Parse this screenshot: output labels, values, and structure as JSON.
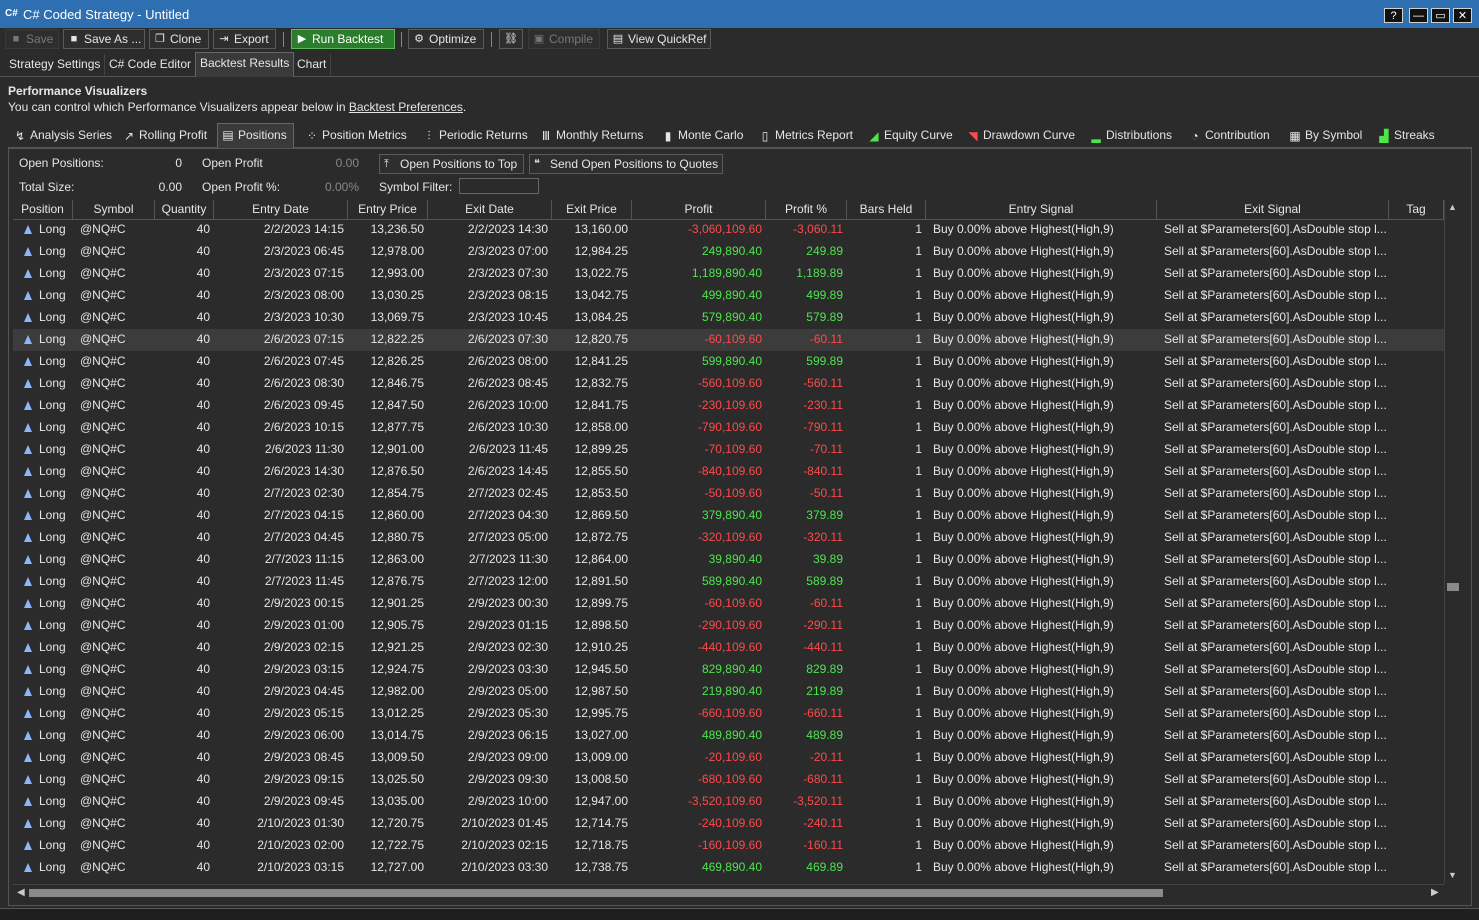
{
  "window": {
    "title": "C# Coded Strategy - Untitled",
    "app_icon": "C#",
    "buttons": [
      "?",
      "—",
      "▭",
      "✕"
    ]
  },
  "toolbar": {
    "save": "Save",
    "save_as": "Save As ...",
    "clone": "Clone",
    "export": "Export",
    "run_backtest": "Run Backtest",
    "optimize": "Optimize",
    "compile": "Compile",
    "view_quickref": "View QuickRef"
  },
  "main_tabs": [
    "Strategy Settings",
    "C# Code Editor",
    "Backtest Results",
    "Chart"
  ],
  "performance": {
    "title": "Performance Visualizers",
    "desc_prefix": "You can control which Performance Visualizers appear below in ",
    "desc_link": "Backtest Preferences",
    "desc_suffix": "."
  },
  "viz_tabs": [
    "Analysis Series",
    "Rolling Profit",
    "Positions",
    "Position Metrics",
    "Periodic Returns",
    "Monthly Returns",
    "Monte Carlo",
    "Metrics Report",
    "Equity Curve",
    "Drawdown Curve",
    "Distributions",
    "Contribution",
    "By Symbol",
    "Streaks"
  ],
  "summary": {
    "open_positions_label": "Open Positions:",
    "open_positions": "0",
    "open_profit_label": "Open Profit",
    "open_profit": "0.00",
    "total_size_label": "Total Size:",
    "total_size": "0.00",
    "open_profit_pct_label": "Open Profit %:",
    "open_profit_pct": "0.00%",
    "symbol_filter_label": "Symbol Filter:",
    "open_to_top_button": "Open Positions to Top",
    "send_to_quotes_button": "Send Open Positions to Quotes"
  },
  "table": {
    "columns": [
      "Position",
      "Symbol",
      "Quantity",
      "Entry Date",
      "Entry Price",
      "Exit Date",
      "Exit Price",
      "Profit",
      "Profit %",
      "Bars Held",
      "Entry Signal",
      "Exit Signal",
      "Tag"
    ],
    "selected_row": 5,
    "rows": [
      [
        "Long",
        "@NQ#C",
        "40",
        "2/2/2023 14:15",
        "13,236.50",
        "2/2/2023 14:30",
        "13,160.00",
        "-3,060,109.60",
        "-3,060.11",
        "1",
        "Buy 0.00% above Highest(High,9)",
        "Sell at $Parameters[60].AsDouble stop l..."
      ],
      [
        "Long",
        "@NQ#C",
        "40",
        "2/3/2023 06:45",
        "12,978.00",
        "2/3/2023 07:00",
        "12,984.25",
        "249,890.40",
        "249.89",
        "1",
        "Buy 0.00% above Highest(High,9)",
        "Sell at $Parameters[60].AsDouble stop l..."
      ],
      [
        "Long",
        "@NQ#C",
        "40",
        "2/3/2023 07:15",
        "12,993.00",
        "2/3/2023 07:30",
        "13,022.75",
        "1,189,890.40",
        "1,189.89",
        "1",
        "Buy 0.00% above Highest(High,9)",
        "Sell at $Parameters[60].AsDouble stop l..."
      ],
      [
        "Long",
        "@NQ#C",
        "40",
        "2/3/2023 08:00",
        "13,030.25",
        "2/3/2023 08:15",
        "13,042.75",
        "499,890.40",
        "499.89",
        "1",
        "Buy 0.00% above Highest(High,9)",
        "Sell at $Parameters[60].AsDouble stop l..."
      ],
      [
        "Long",
        "@NQ#C",
        "40",
        "2/3/2023 10:30",
        "13,069.75",
        "2/3/2023 10:45",
        "13,084.25",
        "579,890.40",
        "579.89",
        "1",
        "Buy 0.00% above Highest(High,9)",
        "Sell at $Parameters[60].AsDouble stop l..."
      ],
      [
        "Long",
        "@NQ#C",
        "40",
        "2/6/2023 07:15",
        "12,822.25",
        "2/6/2023 07:30",
        "12,820.75",
        "-60,109.60",
        "-60.11",
        "1",
        "Buy 0.00% above Highest(High,9)",
        "Sell at $Parameters[60].AsDouble stop l..."
      ],
      [
        "Long",
        "@NQ#C",
        "40",
        "2/6/2023 07:45",
        "12,826.25",
        "2/6/2023 08:00",
        "12,841.25",
        "599,890.40",
        "599.89",
        "1",
        "Buy 0.00% above Highest(High,9)",
        "Sell at $Parameters[60].AsDouble stop l..."
      ],
      [
        "Long",
        "@NQ#C",
        "40",
        "2/6/2023 08:30",
        "12,846.75",
        "2/6/2023 08:45",
        "12,832.75",
        "-560,109.60",
        "-560.11",
        "1",
        "Buy 0.00% above Highest(High,9)",
        "Sell at $Parameters[60].AsDouble stop l..."
      ],
      [
        "Long",
        "@NQ#C",
        "40",
        "2/6/2023 09:45",
        "12,847.50",
        "2/6/2023 10:00",
        "12,841.75",
        "-230,109.60",
        "-230.11",
        "1",
        "Buy 0.00% above Highest(High,9)",
        "Sell at $Parameters[60].AsDouble stop l..."
      ],
      [
        "Long",
        "@NQ#C",
        "40",
        "2/6/2023 10:15",
        "12,877.75",
        "2/6/2023 10:30",
        "12,858.00",
        "-790,109.60",
        "-790.11",
        "1",
        "Buy 0.00% above Highest(High,9)",
        "Sell at $Parameters[60].AsDouble stop l..."
      ],
      [
        "Long",
        "@NQ#C",
        "40",
        "2/6/2023 11:30",
        "12,901.00",
        "2/6/2023 11:45",
        "12,899.25",
        "-70,109.60",
        "-70.11",
        "1",
        "Buy 0.00% above Highest(High,9)",
        "Sell at $Parameters[60].AsDouble stop l..."
      ],
      [
        "Long",
        "@NQ#C",
        "40",
        "2/6/2023 14:30",
        "12,876.50",
        "2/6/2023 14:45",
        "12,855.50",
        "-840,109.60",
        "-840.11",
        "1",
        "Buy 0.00% above Highest(High,9)",
        "Sell at $Parameters[60].AsDouble stop l..."
      ],
      [
        "Long",
        "@NQ#C",
        "40",
        "2/7/2023 02:30",
        "12,854.75",
        "2/7/2023 02:45",
        "12,853.50",
        "-50,109.60",
        "-50.11",
        "1",
        "Buy 0.00% above Highest(High,9)",
        "Sell at $Parameters[60].AsDouble stop l..."
      ],
      [
        "Long",
        "@NQ#C",
        "40",
        "2/7/2023 04:15",
        "12,860.00",
        "2/7/2023 04:30",
        "12,869.50",
        "379,890.40",
        "379.89",
        "1",
        "Buy 0.00% above Highest(High,9)",
        "Sell at $Parameters[60].AsDouble stop l..."
      ],
      [
        "Long",
        "@NQ#C",
        "40",
        "2/7/2023 04:45",
        "12,880.75",
        "2/7/2023 05:00",
        "12,872.75",
        "-320,109.60",
        "-320.11",
        "1",
        "Buy 0.00% above Highest(High,9)",
        "Sell at $Parameters[60].AsDouble stop l..."
      ],
      [
        "Long",
        "@NQ#C",
        "40",
        "2/7/2023 11:15",
        "12,863.00",
        "2/7/2023 11:30",
        "12,864.00",
        "39,890.40",
        "39.89",
        "1",
        "Buy 0.00% above Highest(High,9)",
        "Sell at $Parameters[60].AsDouble stop l..."
      ],
      [
        "Long",
        "@NQ#C",
        "40",
        "2/7/2023 11:45",
        "12,876.75",
        "2/7/2023 12:00",
        "12,891.50",
        "589,890.40",
        "589.89",
        "1",
        "Buy 0.00% above Highest(High,9)",
        "Sell at $Parameters[60].AsDouble stop l..."
      ],
      [
        "Long",
        "@NQ#C",
        "40",
        "2/9/2023 00:15",
        "12,901.25",
        "2/9/2023 00:30",
        "12,899.75",
        "-60,109.60",
        "-60.11",
        "1",
        "Buy 0.00% above Highest(High,9)",
        "Sell at $Parameters[60].AsDouble stop l..."
      ],
      [
        "Long",
        "@NQ#C",
        "40",
        "2/9/2023 01:00",
        "12,905.75",
        "2/9/2023 01:15",
        "12,898.50",
        "-290,109.60",
        "-290.11",
        "1",
        "Buy 0.00% above Highest(High,9)",
        "Sell at $Parameters[60].AsDouble stop l..."
      ],
      [
        "Long",
        "@NQ#C",
        "40",
        "2/9/2023 02:15",
        "12,921.25",
        "2/9/2023 02:30",
        "12,910.25",
        "-440,109.60",
        "-440.11",
        "1",
        "Buy 0.00% above Highest(High,9)",
        "Sell at $Parameters[60].AsDouble stop l..."
      ],
      [
        "Long",
        "@NQ#C",
        "40",
        "2/9/2023 03:15",
        "12,924.75",
        "2/9/2023 03:30",
        "12,945.50",
        "829,890.40",
        "829.89",
        "1",
        "Buy 0.00% above Highest(High,9)",
        "Sell at $Parameters[60].AsDouble stop l..."
      ],
      [
        "Long",
        "@NQ#C",
        "40",
        "2/9/2023 04:45",
        "12,982.00",
        "2/9/2023 05:00",
        "12,987.50",
        "219,890.40",
        "219.89",
        "1",
        "Buy 0.00% above Highest(High,9)",
        "Sell at $Parameters[60].AsDouble stop l..."
      ],
      [
        "Long",
        "@NQ#C",
        "40",
        "2/9/2023 05:15",
        "13,012.25",
        "2/9/2023 05:30",
        "12,995.75",
        "-660,109.60",
        "-660.11",
        "1",
        "Buy 0.00% above Highest(High,9)",
        "Sell at $Parameters[60].AsDouble stop l..."
      ],
      [
        "Long",
        "@NQ#C",
        "40",
        "2/9/2023 06:00",
        "13,014.75",
        "2/9/2023 06:15",
        "13,027.00",
        "489,890.40",
        "489.89",
        "1",
        "Buy 0.00% above Highest(High,9)",
        "Sell at $Parameters[60].AsDouble stop l..."
      ],
      [
        "Long",
        "@NQ#C",
        "40",
        "2/9/2023 08:45",
        "13,009.50",
        "2/9/2023 09:00",
        "13,009.00",
        "-20,109.60",
        "-20.11",
        "1",
        "Buy 0.00% above Highest(High,9)",
        "Sell at $Parameters[60].AsDouble stop l..."
      ],
      [
        "Long",
        "@NQ#C",
        "40",
        "2/9/2023 09:15",
        "13,025.50",
        "2/9/2023 09:30",
        "13,008.50",
        "-680,109.60",
        "-680.11",
        "1",
        "Buy 0.00% above Highest(High,9)",
        "Sell at $Parameters[60].AsDouble stop l..."
      ],
      [
        "Long",
        "@NQ#C",
        "40",
        "2/9/2023 09:45",
        "13,035.00",
        "2/9/2023 10:00",
        "12,947.00",
        "-3,520,109.60",
        "-3,520.11",
        "1",
        "Buy 0.00% above Highest(High,9)",
        "Sell at $Parameters[60].AsDouble stop l..."
      ],
      [
        "Long",
        "@NQ#C",
        "40",
        "2/10/2023 01:30",
        "12,720.75",
        "2/10/2023 01:45",
        "12,714.75",
        "-240,109.60",
        "-240.11",
        "1",
        "Buy 0.00% above Highest(High,9)",
        "Sell at $Parameters[60].AsDouble stop l..."
      ],
      [
        "Long",
        "@NQ#C",
        "40",
        "2/10/2023 02:00",
        "12,722.75",
        "2/10/2023 02:15",
        "12,718.75",
        "-160,109.60",
        "-160.11",
        "1",
        "Buy 0.00% above Highest(High,9)",
        "Sell at $Parameters[60].AsDouble stop l..."
      ],
      [
        "Long",
        "@NQ#C",
        "40",
        "2/10/2023 03:15",
        "12,727.00",
        "2/10/2023 03:30",
        "12,738.75",
        "469,890.40",
        "469.89",
        "1",
        "Buy 0.00% above Highest(High,9)",
        "Sell at $Parameters[60].AsDouble stop l..."
      ]
    ]
  },
  "colors": {
    "positive": "#4ce64c",
    "negative": "#ff4a4a",
    "title_bar": "#2d6fb0",
    "run_button": "#2a7d2a"
  }
}
